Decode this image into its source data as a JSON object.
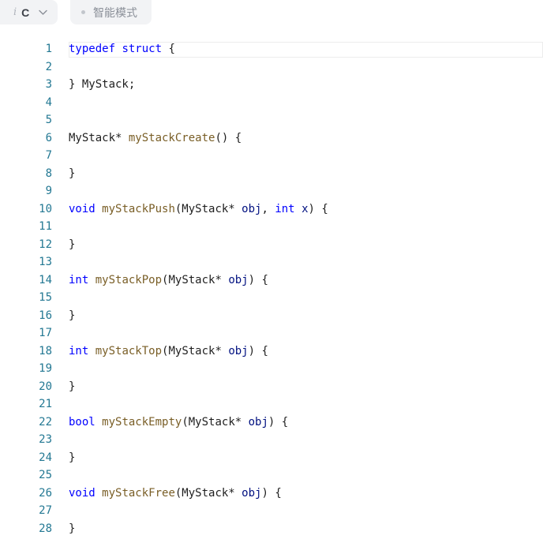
{
  "toolbar": {
    "language_info_glyph": "i",
    "language": "C",
    "mode_label": "智能模式"
  },
  "editor": {
    "lines": [
      {
        "number": "1",
        "tokens": [
          [
            "kw",
            "typedef"
          ],
          [
            "pl",
            " "
          ],
          [
            "kw",
            "struct"
          ],
          [
            "pl",
            " {"
          ]
        ]
      },
      {
        "number": "2",
        "tokens": []
      },
      {
        "number": "3",
        "tokens": [
          [
            "pl",
            "} MyStack;"
          ]
        ]
      },
      {
        "number": "4",
        "tokens": []
      },
      {
        "number": "5",
        "tokens": []
      },
      {
        "number": "6",
        "tokens": [
          [
            "pl",
            "MyStack* "
          ],
          [
            "fn",
            "myStackCreate"
          ],
          [
            "pl",
            "() {"
          ]
        ]
      },
      {
        "number": "7",
        "tokens": []
      },
      {
        "number": "8",
        "tokens": [
          [
            "pl",
            "}"
          ]
        ]
      },
      {
        "number": "9",
        "tokens": []
      },
      {
        "number": "10",
        "tokens": [
          [
            "kw",
            "void"
          ],
          [
            "pl",
            " "
          ],
          [
            "fn",
            "myStackPush"
          ],
          [
            "pl",
            "(MyStack* "
          ],
          [
            "var",
            "obj"
          ],
          [
            "pl",
            ", "
          ],
          [
            "kw",
            "int"
          ],
          [
            "pl",
            " "
          ],
          [
            "var",
            "x"
          ],
          [
            "pl",
            ") {"
          ]
        ]
      },
      {
        "number": "11",
        "tokens": []
      },
      {
        "number": "12",
        "tokens": [
          [
            "pl",
            "}"
          ]
        ]
      },
      {
        "number": "13",
        "tokens": []
      },
      {
        "number": "14",
        "tokens": [
          [
            "kw",
            "int"
          ],
          [
            "pl",
            " "
          ],
          [
            "fn",
            "myStackPop"
          ],
          [
            "pl",
            "(MyStack* "
          ],
          [
            "var",
            "obj"
          ],
          [
            "pl",
            ") {"
          ]
        ]
      },
      {
        "number": "15",
        "tokens": []
      },
      {
        "number": "16",
        "tokens": [
          [
            "pl",
            "}"
          ]
        ]
      },
      {
        "number": "17",
        "tokens": []
      },
      {
        "number": "18",
        "tokens": [
          [
            "kw",
            "int"
          ],
          [
            "pl",
            " "
          ],
          [
            "fn",
            "myStackTop"
          ],
          [
            "pl",
            "(MyStack* "
          ],
          [
            "var",
            "obj"
          ],
          [
            "pl",
            ") {"
          ]
        ]
      },
      {
        "number": "19",
        "tokens": []
      },
      {
        "number": "20",
        "tokens": [
          [
            "pl",
            "}"
          ]
        ]
      },
      {
        "number": "21",
        "tokens": []
      },
      {
        "number": "22",
        "tokens": [
          [
            "kw",
            "bool"
          ],
          [
            "pl",
            " "
          ],
          [
            "fn",
            "myStackEmpty"
          ],
          [
            "pl",
            "(MyStack* "
          ],
          [
            "var",
            "obj"
          ],
          [
            "pl",
            ") {"
          ]
        ]
      },
      {
        "number": "23",
        "tokens": []
      },
      {
        "number": "24",
        "tokens": [
          [
            "pl",
            "}"
          ]
        ]
      },
      {
        "number": "25",
        "tokens": []
      },
      {
        "number": "26",
        "tokens": [
          [
            "kw",
            "void"
          ],
          [
            "pl",
            " "
          ],
          [
            "fn",
            "myStackFree"
          ],
          [
            "pl",
            "(MyStack* "
          ],
          [
            "var",
            "obj"
          ],
          [
            "pl",
            ") {"
          ]
        ]
      },
      {
        "number": "27",
        "tokens": []
      },
      {
        "number": "28",
        "tokens": [
          [
            "pl",
            "}"
          ]
        ]
      }
    ]
  },
  "colors": {
    "keyword": "#0000ff",
    "function": "#795e26",
    "variable": "#001080",
    "line_number": "#237893",
    "plain": "#1e1e1e"
  }
}
